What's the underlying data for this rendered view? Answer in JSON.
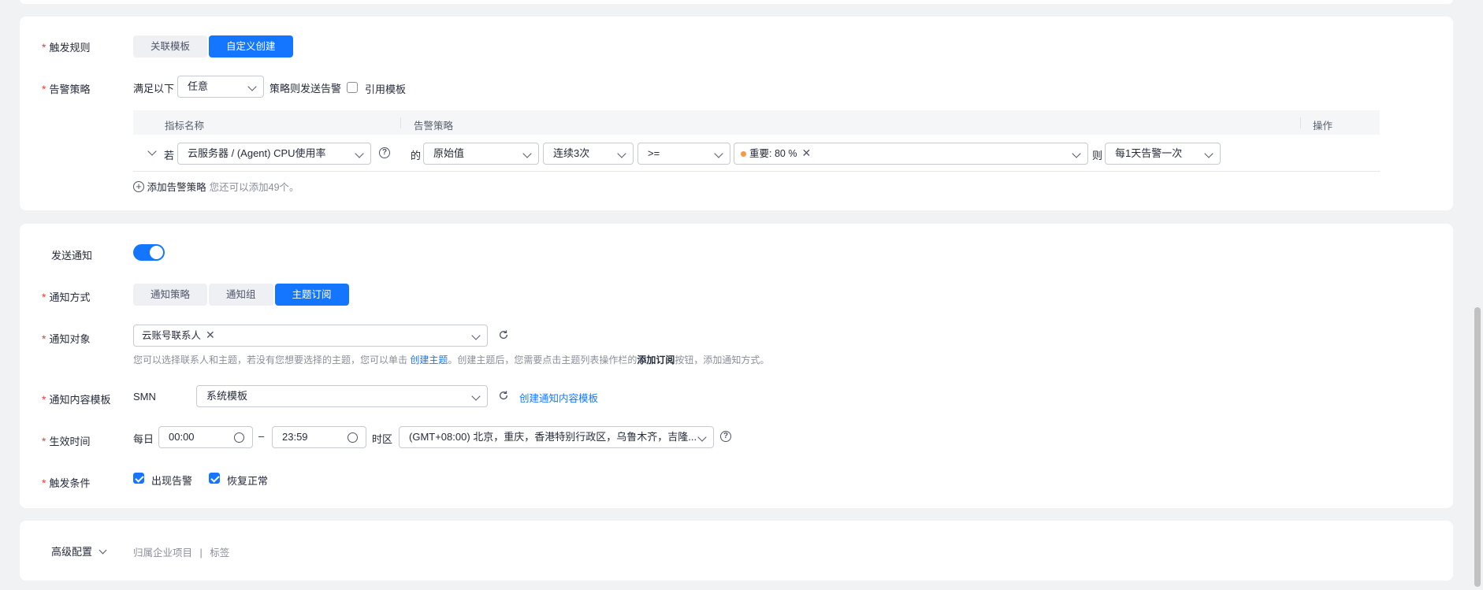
{
  "trigger_rule": {
    "label": "触发规则",
    "options": [
      "关联模板",
      "自定义创建"
    ],
    "active": 1
  },
  "alarm_policy": {
    "label": "告警策略",
    "prefix": "满足以下",
    "match_value": "任意",
    "suffix": "策略则发送告警",
    "use_template_label": "引用模板",
    "table": {
      "headers": {
        "metric": "指标名称",
        "policy": "告警策略",
        "action": "操作"
      },
      "row": {
        "if_label": "若",
        "metric": "云服务器 / (Agent) CPU使用率",
        "of_label": "的",
        "value_type": "原始值",
        "period": "连续3次",
        "operator": ">=",
        "threshold_tag": "重要: 80 %",
        "then_label": "则",
        "frequency": "每1天告警一次"
      }
    },
    "add_link": "添加告警策略",
    "add_hint": "您还可以添加49个。"
  },
  "notify": {
    "send_label": "发送通知",
    "send_enabled": true,
    "method_label": "通知方式",
    "method_options": [
      "通知策略",
      "通知组",
      "主题订阅"
    ],
    "method_active": 2,
    "target_label": "通知对象",
    "target_tag": "云账号联系人",
    "hint_part1": "您可以选择联系人和主题，若没有您想要选择的主题，您可以单击",
    "hint_link": "创建主题",
    "hint_part2": "。创建主题后，您需要点击主题列表操作栏的",
    "hint_bold": "添加订阅",
    "hint_part3": "按钮，添加通知方式。",
    "content_label": "通知内容模板",
    "content_type": "SMN",
    "content_value": "系统模板",
    "content_link": "创建通知内容模板",
    "time_label": "生效时间",
    "time_prefix": "每日",
    "time_start": "00:00",
    "time_sep": "–",
    "time_end": "23:59",
    "tz_label": "时区",
    "tz_value": "(GMT+08:00) 北京，重庆，香港特别行政区，乌鲁木齐，吉隆...",
    "condition_label": "触发条件",
    "conditions": [
      "出现告警",
      "恢复正常"
    ]
  },
  "advanced": {
    "label": "高级配置",
    "items": [
      "归属企业项目",
      "标签"
    ],
    "sep": "|"
  },
  "colors": {
    "primary": "#1476ff",
    "required": "#e8403d",
    "warning_dot": "#fa9841"
  }
}
